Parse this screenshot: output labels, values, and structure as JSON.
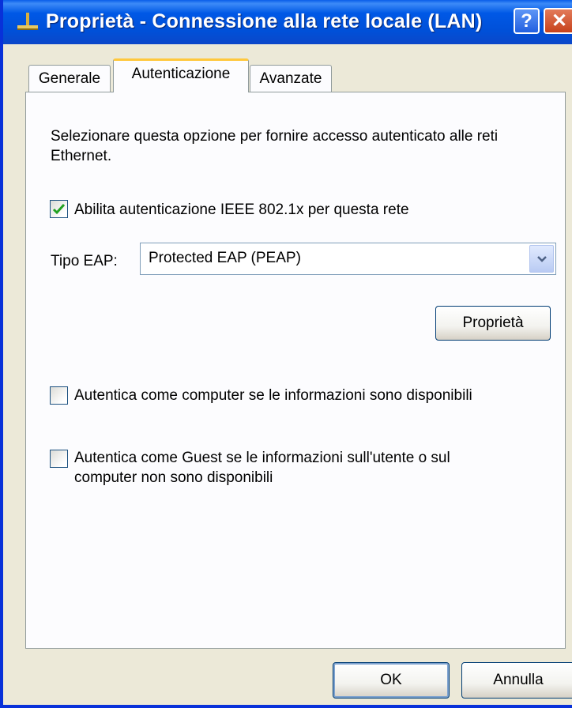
{
  "window": {
    "title": "Proprietà - Connessione alla rete locale (LAN)",
    "help_glyph": "?",
    "close_glyph": "✕"
  },
  "tabs": [
    {
      "label": "Generale"
    },
    {
      "label": "Autenticazione"
    },
    {
      "label": "Avanzate"
    }
  ],
  "auth": {
    "description": "Selezionare questa opzione per fornire accesso autenticato alle reti Ethernet.",
    "enable_8021x": {
      "label": "Abilita autenticazione IEEE 802.1x per questa rete",
      "checked": true
    },
    "eap_type_label": "Tipo EAP:",
    "eap_type_value": "Protected EAP (PEAP)",
    "properties_button": "Proprietà",
    "auth_as_computer": {
      "label": "Autentica come computer se le informazioni sono disponibili",
      "checked": false
    },
    "auth_as_guest": {
      "label": "Autentica come Guest se le informazioni sull'utente o sul computer non sono disponibili",
      "checked": false
    }
  },
  "footer": {
    "ok_label": "OK",
    "cancel_label": "Annulla"
  },
  "colors": {
    "titlebar": "#0058E6",
    "active_tab_accent": "#FFC83C",
    "dialog_bg": "#ECE9D8",
    "checkmark": "#21A121"
  }
}
